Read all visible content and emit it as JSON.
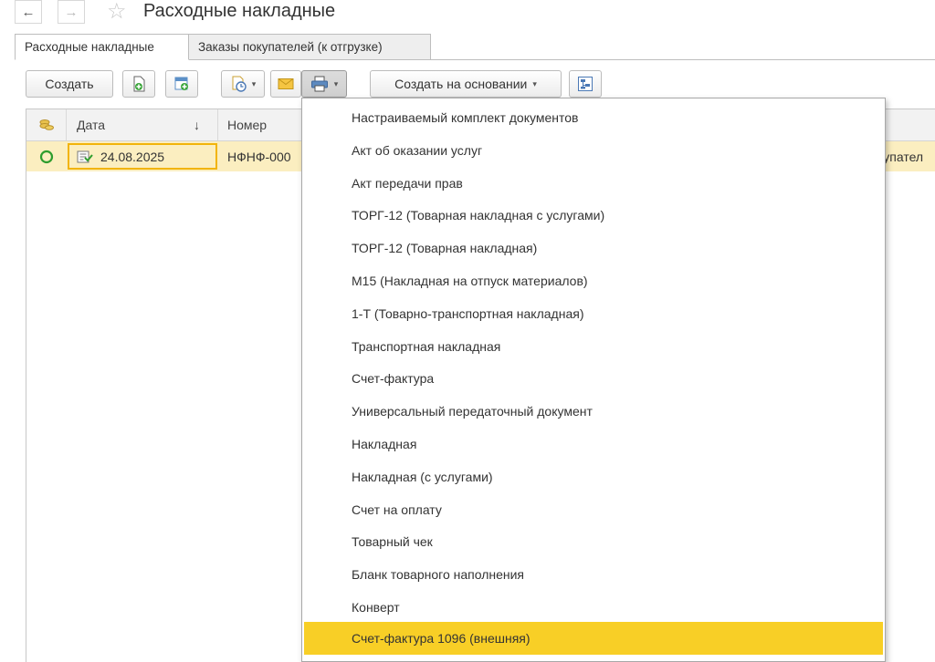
{
  "window": {
    "title": "Расходные накладные",
    "back_label": "←",
    "forward_label": "→",
    "favorite_label": "☆"
  },
  "tabs": [
    {
      "label": "Расходные накладные",
      "active": true
    },
    {
      "label": "Заказы покупателей (к отгрузке)",
      "active": false
    }
  ],
  "toolbar": {
    "create_label": "Создать",
    "create_based_label": "Создать на основании",
    "add_copy_icon": "add-document-icon",
    "add_form_icon": "add-from-template-icon",
    "timer_icon": "document-clock-icon",
    "email_icon": "envelope-icon",
    "print_icon": "printer-icon",
    "structure_icon": "document-structure-icon",
    "caret_label": "▾"
  },
  "grid": {
    "columns": [
      {
        "label": "",
        "icon": "coins-icon"
      },
      {
        "label": "Дата",
        "sort": "↓"
      },
      {
        "label": "Номер"
      }
    ],
    "rows": [
      {
        "status_icon": "circle-status-icon",
        "date": "24.08.2025",
        "number": "НФНФ-000",
        "right_text": "купател"
      }
    ]
  },
  "print_menu": {
    "items": [
      "Настраиваемый комплект документов",
      "Акт об оказании услуг",
      "Акт передачи прав",
      "ТОРГ-12 (Товарная накладная с услугами)",
      "ТОРГ-12 (Товарная накладная)",
      "М15 (Накладная на отпуск материалов)",
      "1-Т (Товарно-транспортная накладная)",
      "Транспортная накладная",
      "Счет-фактура",
      "Универсальный передаточный документ",
      "Накладная",
      "Накладная (с услугами)",
      "Счет на оплату",
      "Товарный чек",
      "Бланк товарного наполнения",
      "Конверт",
      "Счет-фактура 1096 (внешняя)"
    ],
    "highlighted_index": 16
  },
  "colors": {
    "highlight": "#f8cf26",
    "selected_row": "#fbeec0",
    "selected_cell_border": "#f2b40a",
    "status_green": "#2e9d2e"
  }
}
